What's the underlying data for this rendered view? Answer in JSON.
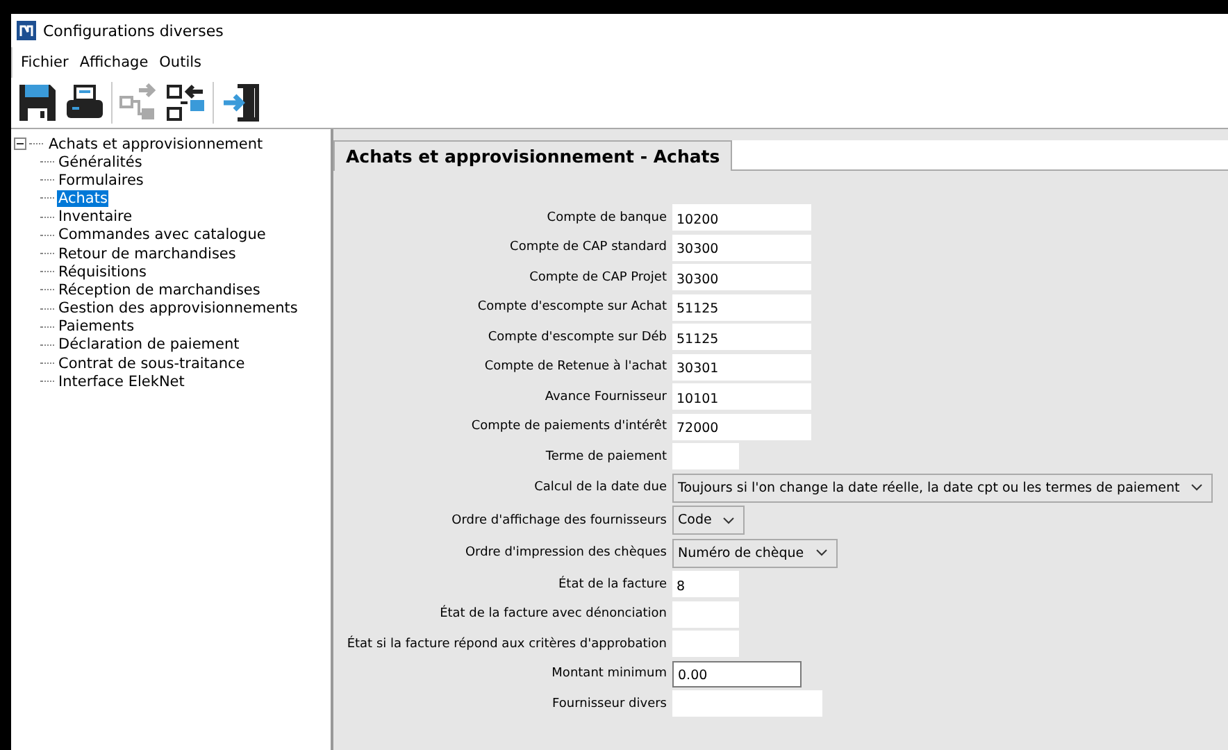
{
  "window": {
    "title": "Configurations diverses"
  },
  "menu": [
    "Fichier",
    "Affichage",
    "Outils"
  ],
  "toolbar": [
    {
      "kind": "save",
      "disabled": false
    },
    {
      "kind": "print",
      "disabled": false
    },
    {
      "kind": "export",
      "disabled": true
    },
    {
      "kind": "import",
      "disabled": false
    },
    {
      "kind": "exit",
      "disabled": false
    }
  ],
  "tree": {
    "label": "Achats et approvisionnement",
    "expanded": true,
    "children": [
      {
        "label": "Généralités",
        "selected": false
      },
      {
        "label": "Formulaires",
        "selected": false
      },
      {
        "label": "Achats",
        "selected": true
      },
      {
        "label": "Inventaire",
        "selected": false
      },
      {
        "label": "Commandes avec catalogue",
        "selected": false
      },
      {
        "label": "Retour de marchandises",
        "selected": false
      },
      {
        "label": "Réquisitions",
        "selected": false
      },
      {
        "label": "Réception de marchandises",
        "selected": false
      },
      {
        "label": "Gestion des approvisionnements",
        "selected": false
      },
      {
        "label": "Paiements",
        "selected": false
      },
      {
        "label": "Déclaration de paiement",
        "selected": false
      },
      {
        "label": "Contrat de sous-traitance",
        "selected": false
      },
      {
        "label": "Interface ElekNet",
        "selected": false
      }
    ]
  },
  "tab": {
    "label": "Achats et approvisionnement - Achats"
  },
  "fields": [
    {
      "label": "Compte de banque",
      "kind": "text",
      "value": "10200"
    },
    {
      "label": "Compte de CAP standard",
      "kind": "text",
      "value": "30300"
    },
    {
      "label": "Compte de CAP Projet",
      "kind": "text",
      "value": "30300"
    },
    {
      "label": "Compte d'escompte sur Achat",
      "kind": "text",
      "value": "51125"
    },
    {
      "label": "Compte d'escompte sur Déb",
      "kind": "text",
      "value": "51125"
    },
    {
      "label": "Compte de Retenue à l'achat",
      "kind": "text",
      "value": "30301"
    },
    {
      "label": "Avance Fournisseur",
      "kind": "text",
      "value": "10101"
    },
    {
      "label": "Compte de paiements d'intérêt",
      "kind": "text",
      "value": "72000"
    },
    {
      "label": "Terme de paiement",
      "kind": "short"
    },
    {
      "label": "Calcul de la date due",
      "kind": "select",
      "value": "Toujours si l'on change la date réelle, la date cpt ou les termes de paiement"
    },
    {
      "label": "Ordre d'affichage des fournisseurs",
      "kind": "select",
      "value": "Code"
    },
    {
      "label": "Ordre d'impression des chèques",
      "kind": "select",
      "value": "Numéro de chèque"
    },
    {
      "label": "État de la facture",
      "kind": "short",
      "value": "8"
    },
    {
      "label": "État de la facture avec dénonciation",
      "kind": "short"
    },
    {
      "label": "État si la facture répond aux critères d'approbation",
      "kind": "short"
    },
    {
      "label": "Montant minimum",
      "kind": "boxed",
      "value": "0.00"
    },
    {
      "label": "Fournisseur divers",
      "kind": "wide"
    }
  ]
}
